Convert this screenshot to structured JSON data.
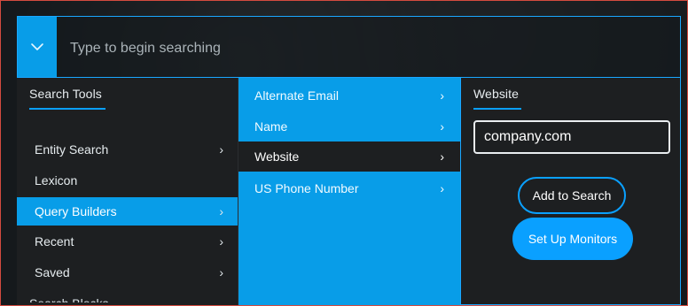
{
  "search": {
    "placeholder": "Type to begin searching",
    "value": ""
  },
  "search_tools": {
    "title": "Search Tools",
    "items": [
      {
        "label": "Entity Search",
        "has_submenu": true
      },
      {
        "label": "Lexicon",
        "has_submenu": false
      },
      {
        "label": "Query Builders",
        "has_submenu": true,
        "active": true
      },
      {
        "label": "Recent",
        "has_submenu": true
      },
      {
        "label": "Saved",
        "has_submenu": true
      }
    ],
    "partially_visible_item": "Search Blocks"
  },
  "query_builders": {
    "items": [
      {
        "label": "Alternate Email",
        "has_submenu": true
      },
      {
        "label": "Name",
        "has_submenu": true
      },
      {
        "label": "Website",
        "has_submenu": true,
        "active": true
      },
      {
        "label": "US Phone Number",
        "has_submenu": true
      }
    ]
  },
  "website_panel": {
    "title": "Website",
    "input_value": "company.com",
    "add_button": "Add to Search",
    "monitors_button": "Set Up Monitors"
  },
  "icons": {
    "toggle": "chevron-down-icon",
    "submenu": "chevron-right-icon"
  },
  "colors": {
    "accent": "#089de8",
    "panel_bg": "#1d1f21",
    "outline_red": "#d44b3f"
  }
}
